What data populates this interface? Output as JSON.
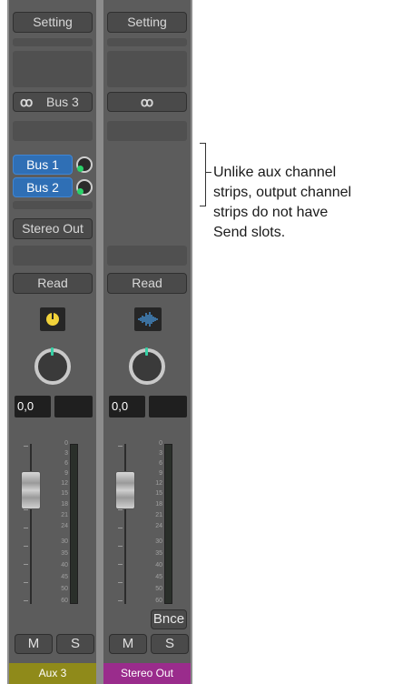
{
  "strips": [
    {
      "setting_label": "Setting",
      "output_label": "Bus 3",
      "link_icon": "link-rings-icon",
      "sends": [
        {
          "label": "Bus 1",
          "dot": "#2bd26a"
        },
        {
          "label": "Bus 2",
          "dot": "#2bd26a"
        }
      ],
      "output_slot": "Stereo Out",
      "automation": "Read",
      "plugin_icon": "yellow-dial-icon",
      "value_left": "0,0",
      "scale": [
        "0",
        "3",
        "6",
        "9",
        "12",
        "15",
        "18",
        "21",
        "24",
        "30",
        "35",
        "40",
        "45",
        "50",
        "60"
      ],
      "mute": "M",
      "solo": "S",
      "name": "Aux 3",
      "name_color": "#8f8a1a"
    },
    {
      "setting_label": "Setting",
      "link_icon": "link-rings-icon",
      "automation": "Read",
      "plugin_icon": "waveform-icon",
      "value_left": "0,0",
      "scale": [
        "0",
        "3",
        "6",
        "9",
        "12",
        "15",
        "18",
        "21",
        "24",
        "30",
        "35",
        "40",
        "45",
        "50",
        "60"
      ],
      "bounce": "Bnce",
      "mute": "M",
      "solo": "S",
      "name": "Stereo Out",
      "name_color": "#9a2c8c"
    }
  ],
  "callout": {
    "lines": [
      "Unlike aux channel",
      "strips, output channel",
      "strips do not have",
      "Send slots."
    ]
  }
}
